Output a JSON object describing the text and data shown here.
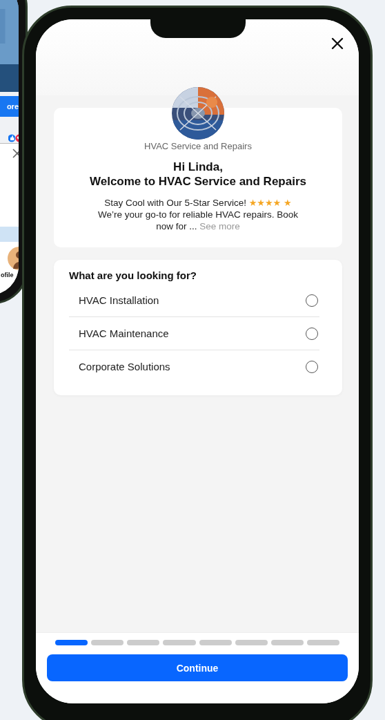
{
  "background_phone": {
    "button_label": "ore",
    "profile_label": "ofile"
  },
  "business_name": "HVAC Service and Repairs",
  "greeting": "Hi Linda,",
  "welcome": "Welcome to HVAC Service and Repairs",
  "description": {
    "text": "Stay Cool with Our 5-Star Service! ★★★★ ★ We’re your go-to for reliable HVAC repairs. Book now for ...",
    "link": "See more"
  },
  "question": "What are you looking for?",
  "options": [
    {
      "label": "HVAC Installation",
      "selected": false
    },
    {
      "label": "HVAC Maintenance",
      "selected": false
    },
    {
      "label": "Corporate Solutions",
      "selected": false
    }
  ],
  "progress": [
    {
      "selected": true
    },
    {
      "selected": false
    },
    {
      "selected": false
    },
    {
      "selected": false
    },
    {
      "selected": false
    },
    {
      "selected": false
    },
    {
      "selected": false
    },
    {
      "selected": false
    }
  ],
  "continue_button": "Continue"
}
